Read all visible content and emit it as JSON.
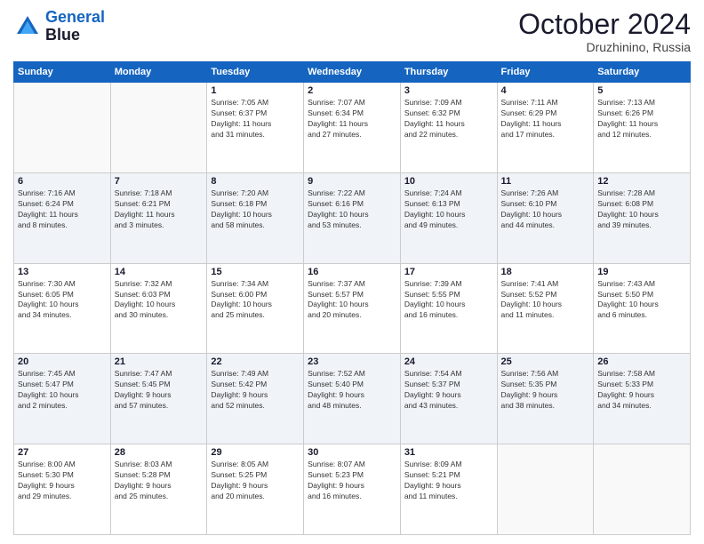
{
  "logo": {
    "line1": "General",
    "line2": "Blue"
  },
  "title": "October 2024",
  "location": "Druzhinino, Russia",
  "days_header": [
    "Sunday",
    "Monday",
    "Tuesday",
    "Wednesday",
    "Thursday",
    "Friday",
    "Saturday"
  ],
  "weeks": [
    [
      {
        "day": "",
        "info": ""
      },
      {
        "day": "",
        "info": ""
      },
      {
        "day": "1",
        "info": "Sunrise: 7:05 AM\nSunset: 6:37 PM\nDaylight: 11 hours\nand 31 minutes."
      },
      {
        "day": "2",
        "info": "Sunrise: 7:07 AM\nSunset: 6:34 PM\nDaylight: 11 hours\nand 27 minutes."
      },
      {
        "day": "3",
        "info": "Sunrise: 7:09 AM\nSunset: 6:32 PM\nDaylight: 11 hours\nand 22 minutes."
      },
      {
        "day": "4",
        "info": "Sunrise: 7:11 AM\nSunset: 6:29 PM\nDaylight: 11 hours\nand 17 minutes."
      },
      {
        "day": "5",
        "info": "Sunrise: 7:13 AM\nSunset: 6:26 PM\nDaylight: 11 hours\nand 12 minutes."
      }
    ],
    [
      {
        "day": "6",
        "info": "Sunrise: 7:16 AM\nSunset: 6:24 PM\nDaylight: 11 hours\nand 8 minutes."
      },
      {
        "day": "7",
        "info": "Sunrise: 7:18 AM\nSunset: 6:21 PM\nDaylight: 11 hours\nand 3 minutes."
      },
      {
        "day": "8",
        "info": "Sunrise: 7:20 AM\nSunset: 6:18 PM\nDaylight: 10 hours\nand 58 minutes."
      },
      {
        "day": "9",
        "info": "Sunrise: 7:22 AM\nSunset: 6:16 PM\nDaylight: 10 hours\nand 53 minutes."
      },
      {
        "day": "10",
        "info": "Sunrise: 7:24 AM\nSunset: 6:13 PM\nDaylight: 10 hours\nand 49 minutes."
      },
      {
        "day": "11",
        "info": "Sunrise: 7:26 AM\nSunset: 6:10 PM\nDaylight: 10 hours\nand 44 minutes."
      },
      {
        "day": "12",
        "info": "Sunrise: 7:28 AM\nSunset: 6:08 PM\nDaylight: 10 hours\nand 39 minutes."
      }
    ],
    [
      {
        "day": "13",
        "info": "Sunrise: 7:30 AM\nSunset: 6:05 PM\nDaylight: 10 hours\nand 34 minutes."
      },
      {
        "day": "14",
        "info": "Sunrise: 7:32 AM\nSunset: 6:03 PM\nDaylight: 10 hours\nand 30 minutes."
      },
      {
        "day": "15",
        "info": "Sunrise: 7:34 AM\nSunset: 6:00 PM\nDaylight: 10 hours\nand 25 minutes."
      },
      {
        "day": "16",
        "info": "Sunrise: 7:37 AM\nSunset: 5:57 PM\nDaylight: 10 hours\nand 20 minutes."
      },
      {
        "day": "17",
        "info": "Sunrise: 7:39 AM\nSunset: 5:55 PM\nDaylight: 10 hours\nand 16 minutes."
      },
      {
        "day": "18",
        "info": "Sunrise: 7:41 AM\nSunset: 5:52 PM\nDaylight: 10 hours\nand 11 minutes."
      },
      {
        "day": "19",
        "info": "Sunrise: 7:43 AM\nSunset: 5:50 PM\nDaylight: 10 hours\nand 6 minutes."
      }
    ],
    [
      {
        "day": "20",
        "info": "Sunrise: 7:45 AM\nSunset: 5:47 PM\nDaylight: 10 hours\nand 2 minutes."
      },
      {
        "day": "21",
        "info": "Sunrise: 7:47 AM\nSunset: 5:45 PM\nDaylight: 9 hours\nand 57 minutes."
      },
      {
        "day": "22",
        "info": "Sunrise: 7:49 AM\nSunset: 5:42 PM\nDaylight: 9 hours\nand 52 minutes."
      },
      {
        "day": "23",
        "info": "Sunrise: 7:52 AM\nSunset: 5:40 PM\nDaylight: 9 hours\nand 48 minutes."
      },
      {
        "day": "24",
        "info": "Sunrise: 7:54 AM\nSunset: 5:37 PM\nDaylight: 9 hours\nand 43 minutes."
      },
      {
        "day": "25",
        "info": "Sunrise: 7:56 AM\nSunset: 5:35 PM\nDaylight: 9 hours\nand 38 minutes."
      },
      {
        "day": "26",
        "info": "Sunrise: 7:58 AM\nSunset: 5:33 PM\nDaylight: 9 hours\nand 34 minutes."
      }
    ],
    [
      {
        "day": "27",
        "info": "Sunrise: 8:00 AM\nSunset: 5:30 PM\nDaylight: 9 hours\nand 29 minutes."
      },
      {
        "day": "28",
        "info": "Sunrise: 8:03 AM\nSunset: 5:28 PM\nDaylight: 9 hours\nand 25 minutes."
      },
      {
        "day": "29",
        "info": "Sunrise: 8:05 AM\nSunset: 5:25 PM\nDaylight: 9 hours\nand 20 minutes."
      },
      {
        "day": "30",
        "info": "Sunrise: 8:07 AM\nSunset: 5:23 PM\nDaylight: 9 hours\nand 16 minutes."
      },
      {
        "day": "31",
        "info": "Sunrise: 8:09 AM\nSunset: 5:21 PM\nDaylight: 9 hours\nand 11 minutes."
      },
      {
        "day": "",
        "info": ""
      },
      {
        "day": "",
        "info": ""
      }
    ]
  ]
}
